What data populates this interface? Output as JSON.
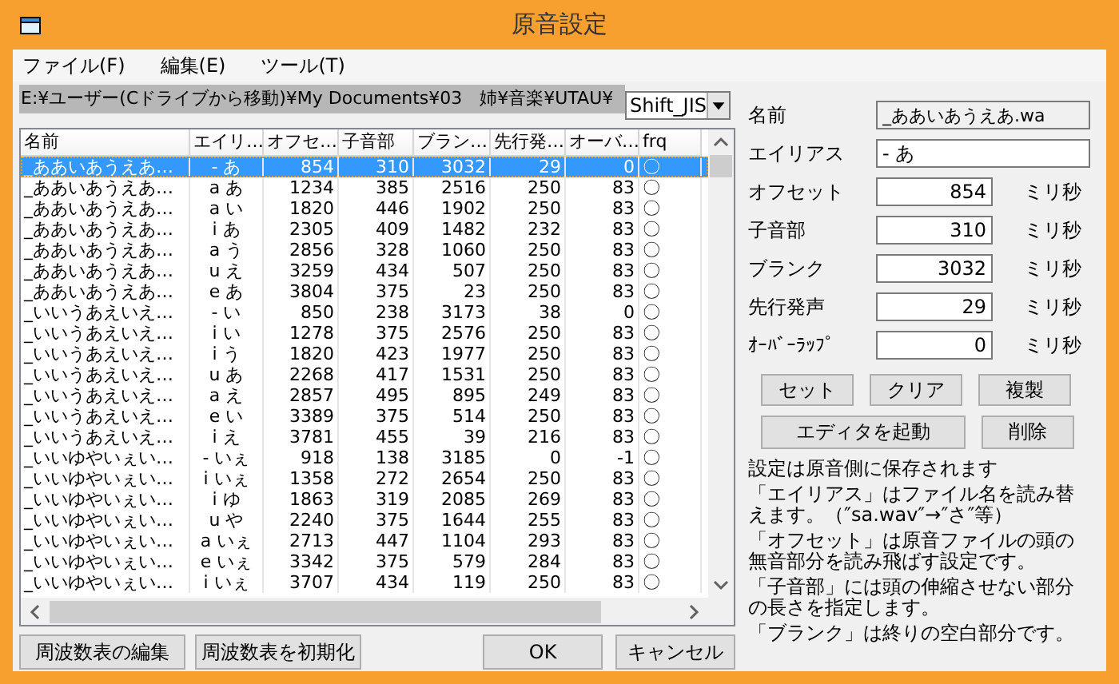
{
  "window": {
    "title": "原音設定"
  },
  "menu": [
    "ファイル(F)",
    "編集(E)",
    "ツール(T)"
  ],
  "path": "E:¥ユーザー(Cドライブから移動)¥My Documents¥03　姉¥音楽¥UTAU¥",
  "encoding": "Shift_JIS",
  "table": {
    "columns": [
      "名前",
      "エイリ…",
      "オフセ…",
      "子音部",
      "ブラン…",
      "先行発…",
      "オーバ…",
      "frq"
    ],
    "rows": [
      {
        "selected": true,
        "cells": [
          "_ああいあうえあ…",
          "- あ",
          "854",
          "310",
          "3032",
          "29",
          "0",
          "〇"
        ]
      },
      {
        "selected": false,
        "cells": [
          "_ああいあうえあ…",
          "a あ",
          "1234",
          "385",
          "2516",
          "250",
          "83",
          "〇"
        ]
      },
      {
        "selected": false,
        "cells": [
          "_ああいあうえあ…",
          "a い",
          "1820",
          "446",
          "1902",
          "250",
          "83",
          "〇"
        ]
      },
      {
        "selected": false,
        "cells": [
          "_ああいあうえあ…",
          "i あ",
          "2305",
          "409",
          "1482",
          "232",
          "83",
          "〇"
        ]
      },
      {
        "selected": false,
        "cells": [
          "_ああいあうえあ…",
          "a う",
          "2856",
          "328",
          "1060",
          "250",
          "83",
          "〇"
        ]
      },
      {
        "selected": false,
        "cells": [
          "_ああいあうえあ…",
          "u え",
          "3259",
          "434",
          "507",
          "250",
          "83",
          "〇"
        ]
      },
      {
        "selected": false,
        "cells": [
          "_ああいあうえあ…",
          "e あ",
          "3804",
          "375",
          "23",
          "250",
          "83",
          "〇"
        ]
      },
      {
        "selected": false,
        "cells": [
          "_いいうあえいえ…",
          "- い",
          "850",
          "238",
          "3173",
          "38",
          "0",
          "〇"
        ]
      },
      {
        "selected": false,
        "cells": [
          "_いいうあえいえ…",
          "i い",
          "1278",
          "375",
          "2576",
          "250",
          "83",
          "〇"
        ]
      },
      {
        "selected": false,
        "cells": [
          "_いいうあえいえ…",
          "i う",
          "1820",
          "423",
          "1977",
          "250",
          "83",
          "〇"
        ]
      },
      {
        "selected": false,
        "cells": [
          "_いいうあえいえ…",
          "u あ",
          "2268",
          "417",
          "1531",
          "250",
          "83",
          "〇"
        ]
      },
      {
        "selected": false,
        "cells": [
          "_いいうあえいえ…",
          "a え",
          "2857",
          "495",
          "895",
          "249",
          "83",
          "〇"
        ]
      },
      {
        "selected": false,
        "cells": [
          "_いいうあえいえ…",
          "e い",
          "3389",
          "375",
          "514",
          "250",
          "83",
          "〇"
        ]
      },
      {
        "selected": false,
        "cells": [
          "_いいうあえいえ…",
          "i え",
          "3781",
          "455",
          "39",
          "216",
          "83",
          "〇"
        ]
      },
      {
        "selected": false,
        "cells": [
          "_いいゆやいぇい…",
          "- いぇ",
          "918",
          "138",
          "3185",
          "0",
          "-1",
          "〇"
        ]
      },
      {
        "selected": false,
        "cells": [
          "_いいゆやいぇい…",
          "i いぇ",
          "1358",
          "272",
          "2654",
          "250",
          "83",
          "〇"
        ]
      },
      {
        "selected": false,
        "cells": [
          "_いいゆやいぇい…",
          "i ゆ",
          "1863",
          "319",
          "2085",
          "269",
          "83",
          "〇"
        ]
      },
      {
        "selected": false,
        "cells": [
          "_いいゆやいぇい…",
          "u や",
          "2240",
          "375",
          "1644",
          "255",
          "83",
          "〇"
        ]
      },
      {
        "selected": false,
        "cells": [
          "_いいゆやいぇい…",
          "a いぇ",
          "2713",
          "447",
          "1104",
          "293",
          "83",
          "〇"
        ]
      },
      {
        "selected": false,
        "cells": [
          "_いいゆやいぇい…",
          "e いぇ",
          "3342",
          "375",
          "579",
          "284",
          "83",
          "〇"
        ]
      },
      {
        "selected": false,
        "cells": [
          "_いいゆやいぇい…",
          "i いぇ",
          "3707",
          "434",
          "119",
          "250",
          "83",
          "〇"
        ]
      }
    ]
  },
  "footer_buttons": [
    "周波数表の編集",
    "周波数表を初期化",
    "OK",
    "キャンセル"
  ],
  "fields": [
    {
      "kind": "text",
      "label": "名前",
      "value": "_ああいあうえあ.wa",
      "readonly": true
    },
    {
      "kind": "text",
      "label": "エイリアス",
      "value": "- あ",
      "readonly": false
    },
    {
      "kind": "number",
      "label": "オフセット",
      "value": "854",
      "unit": "ミリ秒"
    },
    {
      "kind": "number",
      "label": "子音部",
      "value": "310",
      "unit": "ミリ秒"
    },
    {
      "kind": "number",
      "label": "ブランク",
      "value": "3032",
      "unit": "ミリ秒"
    },
    {
      "kind": "number",
      "label": "先行発声",
      "value": "29",
      "unit": "ミリ秒"
    },
    {
      "kind": "number",
      "label": "ｵｰﾊﾞｰﾗｯﾌﾟ",
      "value": "0",
      "unit": "ミリ秒"
    }
  ],
  "panel_buttons": [
    [
      "セット",
      "クリア",
      "複製"
    ],
    [
      "エディタを起動",
      "削除"
    ]
  ],
  "notes": [
    "設定は原音側に保存されます",
    "「エイリアス」はファイル名を読み替えます。（″sa.wav″→″さ″等）",
    "「オフセット」は原音ファイルの頭の無音部分を読み飛ばす設定です。",
    "「子音部」には頭の伸縮させない部分の長さを指定します。",
    "「ブランク」は終りの空白部分です。"
  ]
}
